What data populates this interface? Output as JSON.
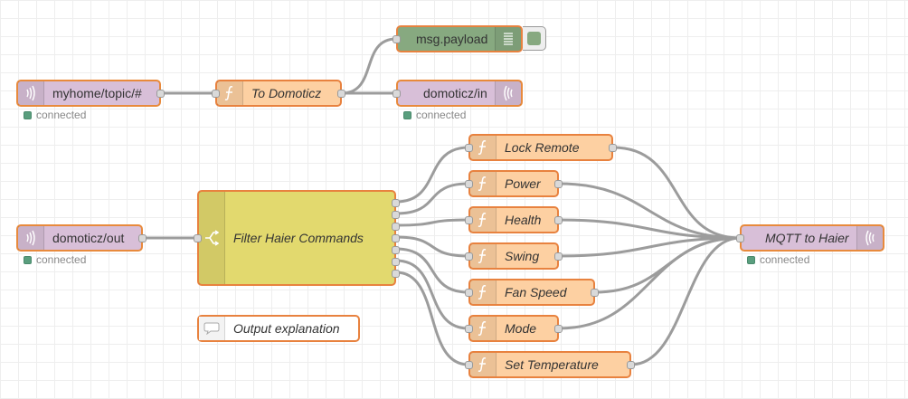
{
  "nodes": {
    "mqtt_in_topic": {
      "label": "myhome/topic/#",
      "status": "connected",
      "icon": "mqtt-wave-icon"
    },
    "to_domoticz": {
      "label": "To Domoticz",
      "icon": "function-icon"
    },
    "debug_payload": {
      "label": "msg.payload",
      "icon": "list-icon"
    },
    "mqtt_out_domoticz_in": {
      "label": "domoticz/in",
      "status": "connected",
      "icon": "mqtt-wave-icon"
    },
    "mqtt_in_domoticz_out": {
      "label": "domoticz/out",
      "status": "connected",
      "icon": "mqtt-wave-icon"
    },
    "filter_haier": {
      "label": "Filter Haier Commands",
      "icon": "switch-icon"
    },
    "lock_remote": {
      "label": "Lock Remote",
      "icon": "function-icon"
    },
    "power": {
      "label": "Power",
      "icon": "function-icon"
    },
    "health": {
      "label": "Health",
      "icon": "function-icon"
    },
    "swing": {
      "label": "Swing",
      "icon": "function-icon"
    },
    "fan_speed": {
      "label": "Fan Speed",
      "icon": "function-icon"
    },
    "mode": {
      "label": "Mode",
      "icon": "function-icon"
    },
    "set_temperature": {
      "label": "Set Temperature",
      "icon": "function-icon"
    },
    "mqtt_to_haier": {
      "label": "MQTT to Haier",
      "status": "connected",
      "icon": "mqtt-wave-icon"
    },
    "output_explanation": {
      "label": "Output explanation",
      "icon": "comment-icon"
    }
  },
  "colors": {
    "mqtt": "#d8bfd8",
    "function": "#fdd0a2",
    "switch": "#e2d96e",
    "debug": "#87a980",
    "status_connected": "#5a9e7e",
    "wire": "#999999"
  }
}
